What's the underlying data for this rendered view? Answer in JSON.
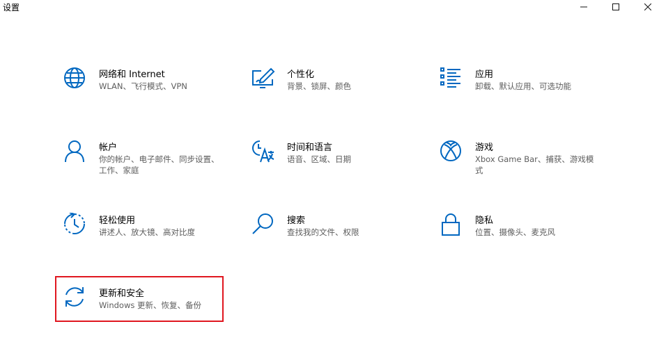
{
  "window": {
    "title": "设置",
    "controls": {
      "minimize": "minimize-icon",
      "maximize": "maximize-icon",
      "close": "close-icon"
    }
  },
  "accent_color": "#0067c0",
  "highlight_color": "#e0161f",
  "tiles": [
    {
      "id": "network",
      "title": "网络和 Internet",
      "desc": "WLAN、飞行模式、VPN",
      "icon": "globe-icon"
    },
    {
      "id": "personalization",
      "title": "个性化",
      "desc": "背景、锁屏、颜色",
      "icon": "pen-tablet-icon"
    },
    {
      "id": "apps",
      "title": "应用",
      "desc": "卸载、默认应用、可选功能",
      "icon": "app-list-icon"
    },
    {
      "id": "accounts",
      "title": "帐户",
      "desc": "你的帐户、电子邮件、同步设置、工作、家庭",
      "icon": "person-icon"
    },
    {
      "id": "time-language",
      "title": "时间和语言",
      "desc": "语音、区域、日期",
      "icon": "time-language-icon"
    },
    {
      "id": "gaming",
      "title": "游戏",
      "desc": "Xbox Game Bar、捕获、游戏模式",
      "icon": "xbox-icon"
    },
    {
      "id": "ease-of-access",
      "title": "轻松使用",
      "desc": "讲述人、放大镜、高对比度",
      "icon": "ease-of-access-icon"
    },
    {
      "id": "search",
      "title": "搜索",
      "desc": "查找我的文件、权限",
      "icon": "search-icon"
    },
    {
      "id": "privacy",
      "title": "隐私",
      "desc": "位置、摄像头、麦克风",
      "icon": "lock-icon"
    },
    {
      "id": "update-security",
      "title": "更新和安全",
      "desc": "Windows 更新、恢复、备份",
      "icon": "sync-arrows-icon"
    }
  ]
}
